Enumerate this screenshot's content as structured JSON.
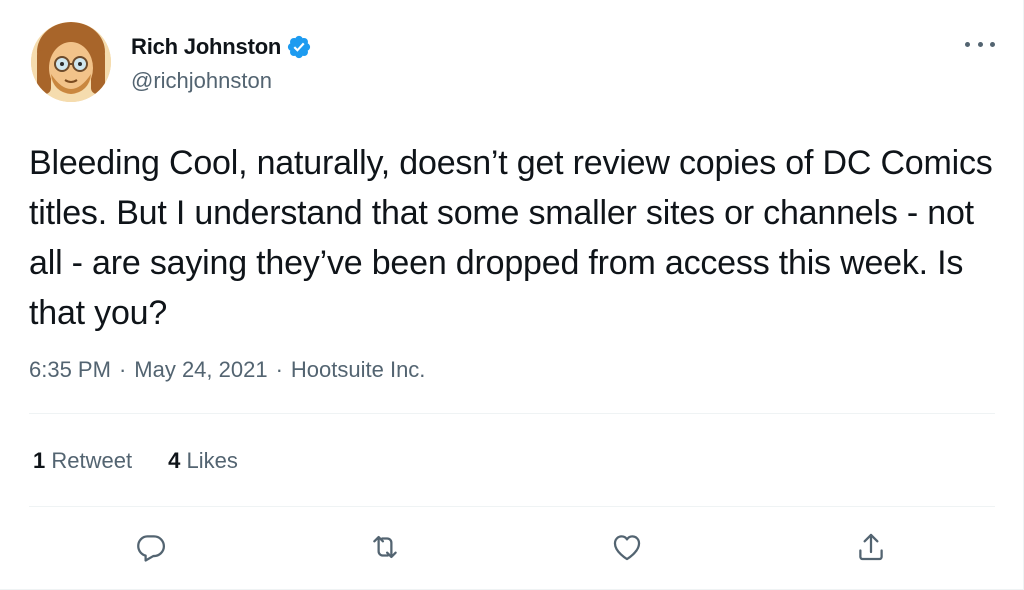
{
  "author": {
    "display_name": "Rich Johnston",
    "handle": "@richjohnston",
    "verified": true
  },
  "tweet": {
    "text": "Bleeding Cool, naturally, doesn’t get review copies of DC Comics titles. But I understand that some smaller sites or channels - not all - are saying they’ve been dropped from access this week. Is that you?",
    "time": "6:35 PM",
    "date": "May 24, 2021",
    "source": "Hootsuite Inc.",
    "separator": "·"
  },
  "stats": {
    "retweets_count": "1",
    "retweets_label": "Retweet",
    "likes_count": "4",
    "likes_label": "Likes"
  },
  "icons": {
    "more": "more-horizontal-icon",
    "reply": "reply-icon",
    "retweet": "retweet-icon",
    "like": "heart-icon",
    "share": "share-icon",
    "verified": "verified-badge-icon"
  },
  "colors": {
    "text_primary": "#0f1419",
    "text_secondary": "#536471",
    "verified_blue": "#1d9bf0",
    "divider": "#eff3f4"
  }
}
